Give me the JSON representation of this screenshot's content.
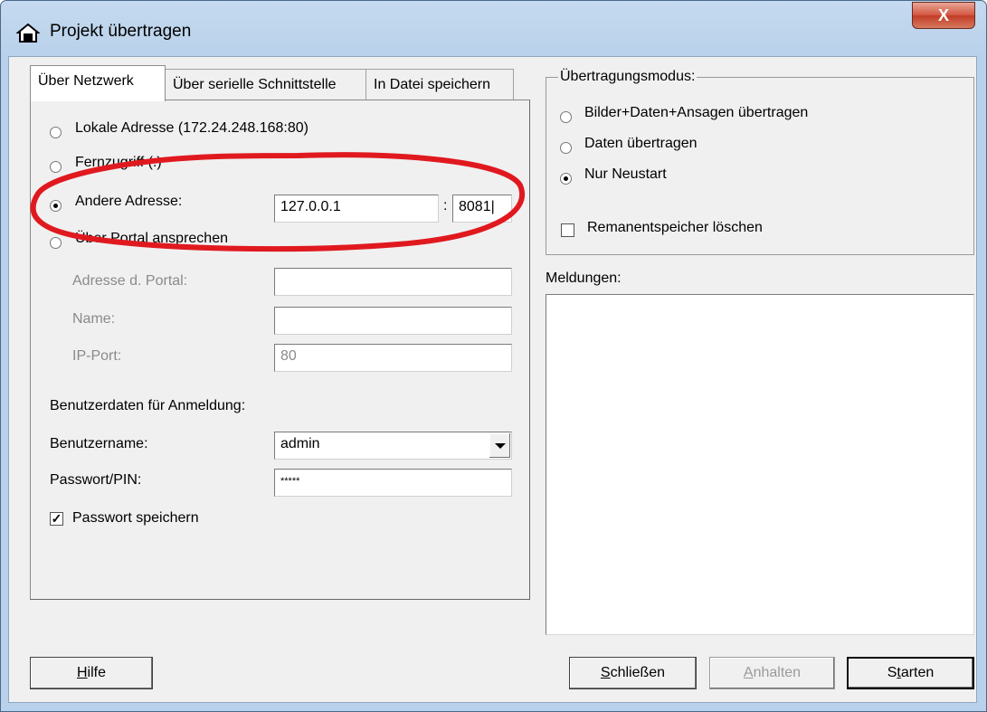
{
  "window": {
    "title": "Projekt übertragen",
    "close_label": "X"
  },
  "tabs": [
    {
      "label": "Über Netzwerk"
    },
    {
      "label": "Über serielle Schnittstelle"
    },
    {
      "label": "In Datei speichern"
    }
  ],
  "network": {
    "local": {
      "label": "Lokale Adresse (172.24.248.168:80)",
      "checked": false
    },
    "remote": {
      "label": "Fernzugriff (:)",
      "checked": false
    },
    "other": {
      "label": "Andere Adresse:",
      "checked": true,
      "address_value": "127.0.0.1",
      "separator": ":",
      "port_value": "8081"
    },
    "portal": {
      "label": "Über Portal ansprechen",
      "checked": false
    },
    "portal_fields": [
      {
        "label": "Adresse d. Portal:",
        "value": ""
      },
      {
        "label": "Name:",
        "value": ""
      },
      {
        "label": "IP-Port:",
        "value": "80"
      }
    ],
    "credentials_heading": "Benutzerdaten für Anmeldung:",
    "username": {
      "label": "Benutzername:",
      "value": "admin"
    },
    "password": {
      "label": "Passwort/PIN:",
      "value": "*****"
    },
    "save_password": {
      "label": "Passwort speichern",
      "checked": true,
      "mark": "✓"
    }
  },
  "transfer_mode": {
    "title": "Übertragungsmodus:",
    "options": [
      {
        "label": "Bilder+Daten+Ansagen übertragen",
        "checked": false
      },
      {
        "label": "Daten übertragen",
        "checked": false
      },
      {
        "label": "Nur Neustart",
        "checked": true
      }
    ],
    "clear_retain": {
      "label": "Remanentspeicher löschen",
      "checked": false
    }
  },
  "messages": {
    "label": "Meldungen:"
  },
  "buttons": {
    "help": {
      "key": "H",
      "rest": "ilfe"
    },
    "close": {
      "key": "S",
      "rest": "chließen"
    },
    "pause": {
      "key": "A",
      "rest": "nhalten"
    },
    "start": {
      "pre": "S",
      "key": "t",
      "rest": "arten"
    }
  },
  "colors": {
    "annotation": "#e0191f",
    "title_gradient_top": "#c5daf0",
    "close_red": "#c23b25"
  }
}
